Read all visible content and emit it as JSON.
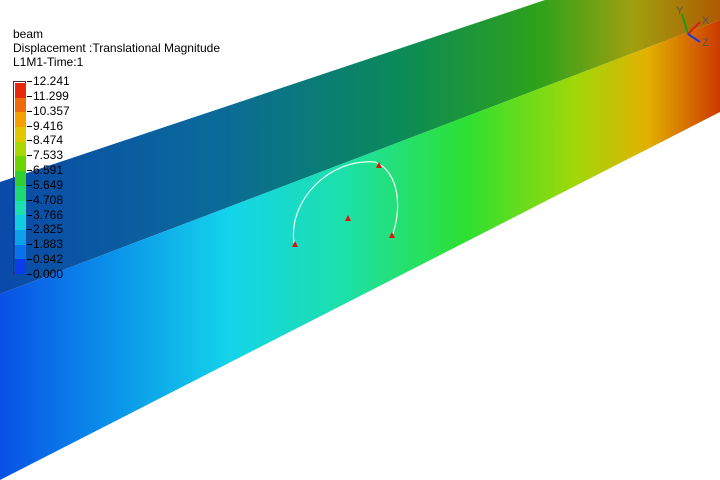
{
  "header": {
    "model_name": "beam",
    "result_type": "Displacement :Translational Magnitude",
    "load_case": "L1M1-Time:1"
  },
  "legend": {
    "values": [
      "12.241",
      "11.299",
      "10.357",
      "9.416",
      "8.474",
      "7.533",
      "6.591",
      "5.649",
      "4.708",
      "3.766",
      "2.825",
      "1.883",
      "0.942",
      "0.000"
    ],
    "colors": [
      "#e8280a",
      "#ef6a0a",
      "#f5a000",
      "#e2c800",
      "#a8d800",
      "#6cd400",
      "#2fd030",
      "#20d870",
      "#1ce0b0",
      "#14cce0",
      "#0ea0e8",
      "#0a72ea",
      "#0a3ce8"
    ]
  },
  "triad": {
    "x_label": "X",
    "y_label": "Y",
    "z_label": "Z"
  }
}
